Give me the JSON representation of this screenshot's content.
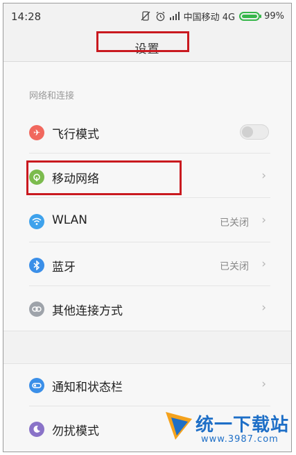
{
  "statusbar": {
    "time": "14:28",
    "carrier": "中国移动 4G",
    "battery_percent": "99%",
    "icons": [
      "vibrate-off-icon",
      "alarm-icon",
      "signal-icon",
      "battery-icon"
    ],
    "battery_level": 0.99
  },
  "header": {
    "title": "设置"
  },
  "section": {
    "label": "网络和连接"
  },
  "settings": {
    "airplane": {
      "label": "飞行模式",
      "icon": "airplane-icon",
      "color": "#f1685e",
      "enabled": false
    },
    "mobile": {
      "label": "移动网络",
      "icon": "mobile-network-icon",
      "color": "#7cbb4e"
    },
    "wlan": {
      "label": "WLAN",
      "value": "已关闭",
      "icon": "wifi-icon",
      "color": "#3ea2ec"
    },
    "bluetooth": {
      "label": "蓝牙",
      "value": "已关闭",
      "icon": "bluetooth-icon",
      "color": "#3b8fe8"
    },
    "other": {
      "label": "其他连接方式",
      "icon": "link-icon",
      "color": "#9ea3aa"
    },
    "notification": {
      "label": "通知和状态栏",
      "icon": "notification-icon",
      "color": "#3b8fe8"
    },
    "dnd": {
      "label": "勿扰模式",
      "icon": "moon-icon",
      "color": "#8a73c8"
    }
  },
  "watermark": {
    "name": "统一下载站",
    "url": "www.3987.com"
  },
  "colors": {
    "highlight_box": "#c9191f",
    "background": "#f7f7f7"
  }
}
